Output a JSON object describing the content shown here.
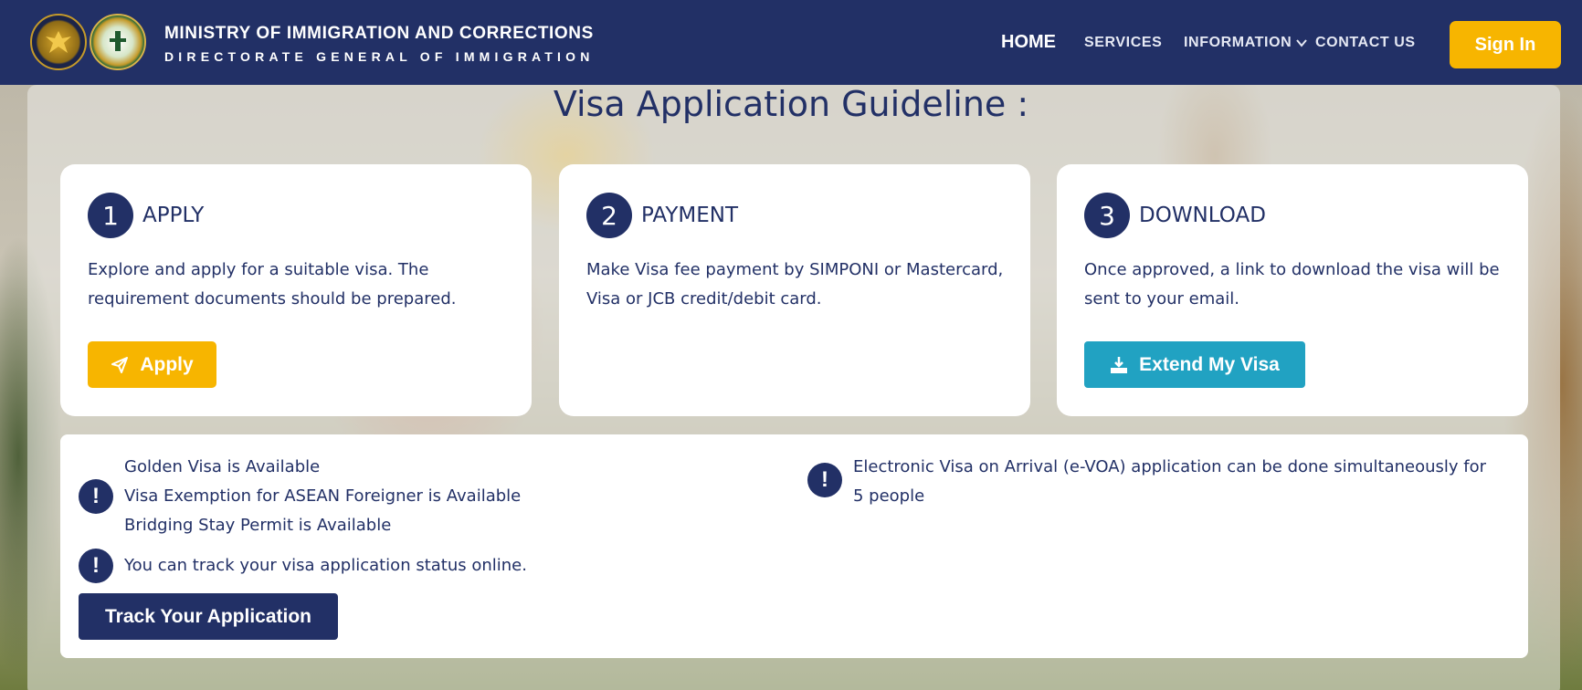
{
  "header": {
    "brand_line1": "MINISTRY OF IMMIGRATION AND CORRECTIONS",
    "brand_line2": "DIRECTORATE GENERAL OF IMMIGRATION",
    "nav": {
      "home": "HOME",
      "services": "SERVICES",
      "information": "INFORMATION",
      "contact": "CONTACT US"
    },
    "sign_in": "Sign In",
    "colors": {
      "bar": "#223066",
      "accent": "#f7b500"
    }
  },
  "main": {
    "title": "Visa Application Guideline :",
    "steps": [
      {
        "number": "1",
        "title": "APPLY",
        "description": "Explore and apply for a suitable visa. The requirement documents should be prepared.",
        "button": {
          "label": "Apply",
          "icon": "paper-plane-icon",
          "color": "#f7b500"
        }
      },
      {
        "number": "2",
        "title": "PAYMENT",
        "description": "Make Visa fee payment by SIMPONI or Mastercard, Visa or JCB credit/debit card."
      },
      {
        "number": "3",
        "title": "DOWNLOAD",
        "description": "Once approved, a link to download the visa will be sent to your email.",
        "button": {
          "label": "Extend My Visa",
          "icon": "download-icon",
          "color": "#21a2c2"
        }
      }
    ],
    "notices": {
      "availability": [
        "Golden Visa is Available",
        "Visa Exemption for ASEAN Foreigner is Available",
        "Bridging Stay Permit is Available"
      ],
      "evoa": "Electronic Visa on Arrival (e-VOA) application can be done simultaneously for 5 people",
      "track_status": "You can track your visa application status online.",
      "track_button": "Track Your Application",
      "icon": "exclamation-icon"
    }
  }
}
